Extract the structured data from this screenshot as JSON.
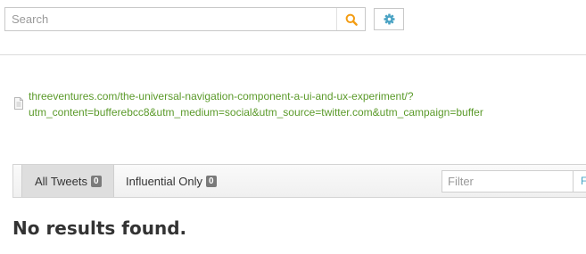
{
  "search": {
    "placeholder": "Search",
    "value": "",
    "button_icon": "search-icon",
    "accent_color": "#f39c12"
  },
  "settings": {
    "icon": "gear-icon",
    "icon_color": "#4aa3c4"
  },
  "page": {
    "icon": "document-icon",
    "url_text": "threeventures.com/the-universal-navigation-component-a-ui-and-ux-experiment/?utm_content=bufferebcc8&utm_medium=social&utm_source=twitter.com&utm_campaign=buffer",
    "link_color": "#5b9a2a"
  },
  "tabs": [
    {
      "label": "All Tweets",
      "count": "0",
      "active": true
    },
    {
      "label": "Influential Only",
      "count": "0",
      "active": false
    }
  ],
  "filter": {
    "placeholder": "Filter",
    "value": "",
    "button_label": "F"
  },
  "results": {
    "empty_message": "No results found."
  }
}
